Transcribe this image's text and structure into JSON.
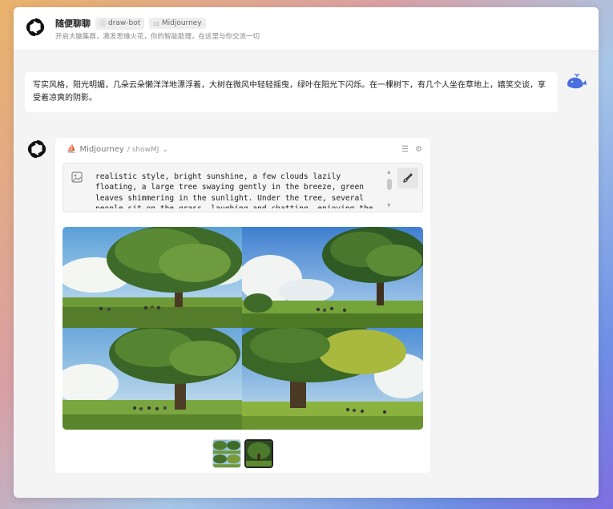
{
  "header": {
    "title": "随便聊聊",
    "tags": [
      "draw-bot",
      "Midjourney"
    ],
    "subtitle": "开启大脑集群，激发思维火花，你的智能助理，在这里与你交流一切"
  },
  "user_message": {
    "text": "写实风格，阳光明媚，几朵云朵懒洋洋地漂浮着，大树在微风中轻轻摇曳，绿叶在阳光下闪烁。在一棵树下，有几个人坐在草地上，嬉笑交谈，享受着凉爽的阴影。"
  },
  "bot_message": {
    "plugin_name": "Midjourney",
    "plugin_sub": "/ showMJ",
    "prompt": "realistic style, bright sunshine, a few clouds lazily floating, a large tree swaying gently in the breeze, green leaves shimmering in the sunlight. Under the tree, several people sit on the grass, laughing and chatting, enjoying the cool shade.",
    "images": [
      "tree-scene-1",
      "tree-scene-2",
      "tree-scene-3",
      "tree-scene-4"
    ],
    "selected_thumbnail": 2
  },
  "icons": {
    "logo": "openai-logo-icon",
    "user_avatar": "whale-icon",
    "image": "image-icon",
    "brush": "brush-icon",
    "list": "list-icon",
    "settings": "gear-icon"
  },
  "colors": {
    "accent": "#4a6ee0",
    "card": "#ffffff",
    "window": "#f4f4f5"
  }
}
